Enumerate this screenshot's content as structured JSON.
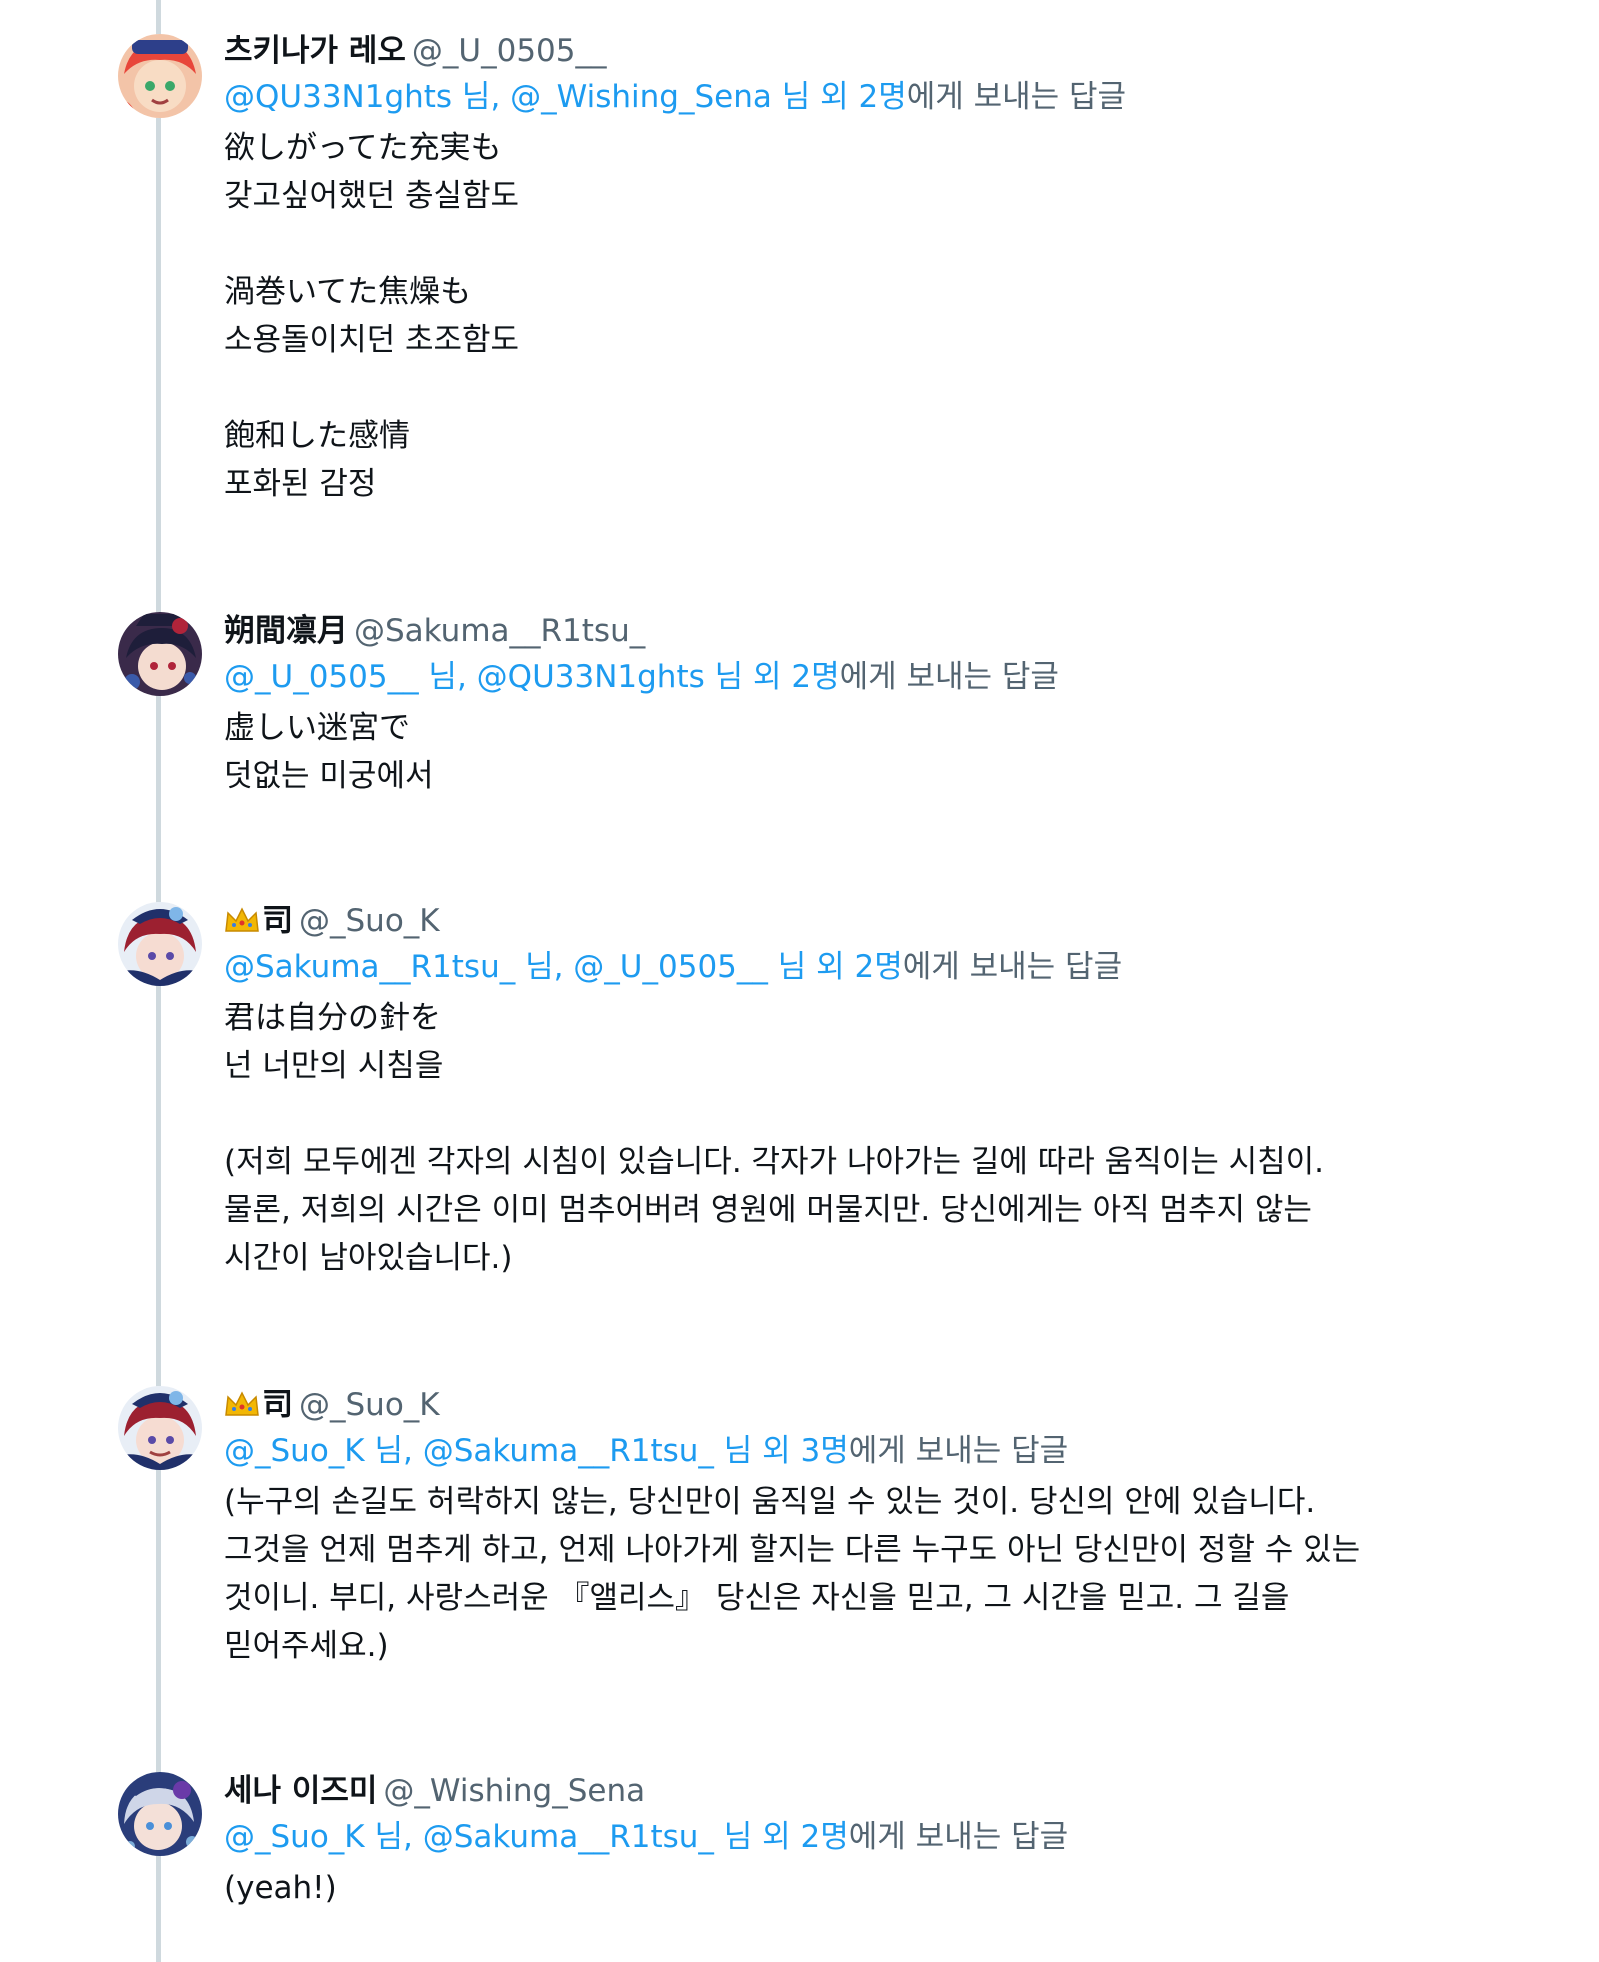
{
  "tweets": [
    {
      "display_name": "츠키나가 레오",
      "handle": "@_U_0505__",
      "reply_to": "@QU33N1ghts 님, @_Wishing_Sena 님 외 2명",
      "reply_suffix": "에게 보내는 답글",
      "text": "欲しがってた充実も\n갖고싶어했던 충실함도\n\n渦巻いてた焦燥も\n소용돌이치던 초조함도\n\n飽和した感情\n포화된 감정",
      "avatar_colors": [
        "#e8463a",
        "#2d3f8a",
        "#f5d08a"
      ]
    },
    {
      "display_name": "朔間凛月",
      "handle": "@Sakuma__R1tsu_",
      "reply_to": "@_U_0505__ 님, @QU33N1ghts 님 외 2명",
      "reply_suffix": "에게 보내는 답글",
      "text": "虚しい迷宮で\n덧없는 미궁에서",
      "avatar_colors": [
        "#1e1e3a",
        "#b0243a",
        "#3a6fd1"
      ]
    },
    {
      "crown_icon": "crown-emoji",
      "display_name": "司",
      "handle": "@_Suo_K",
      "reply_to": "@Sakuma__R1tsu_ 님, @_U_0505__ 님 외 2명",
      "reply_suffix": "에게 보내는 답글",
      "text": "君は自分の針を\n넌 너만의 시침을\n\n(저희 모두에겐 각자의 시침이 있습니다. 각자가 나아가는 길에 따라 움직이는 시침이.\n물론, 저희의 시간은 이미 멈추어버려 영원에 머물지만. 당신에게는 아직 멈추지 않는\n시간이 남아있습니다.)",
      "avatar_colors": [
        "#9c2030",
        "#20306a",
        "#7fb6e8"
      ]
    },
    {
      "crown_icon": "crown-emoji",
      "display_name": "司",
      "handle": "@_Suo_K",
      "reply_to": "@_Suo_K 님, @Sakuma__R1tsu_ 님 외 3명",
      "reply_suffix": "에게 보내는 답글",
      "text": "(누구의 손길도 허락하지 않는, 당신만이 움직일 수 있는 것이. 당신의 안에 있습니다.\n그것을 언제 멈추게 하고, 언제 나아가게 할지는 다른 누구도 아닌 당신만이 정할 수 있는\n것이니. 부디, 사랑스러운 『앨리스』 당신은 자신을 믿고, 그 시간을 믿고. 그 길을\n믿어주세요.)",
      "avatar_colors": [
        "#9c2030",
        "#20306a",
        "#7fb6e8"
      ]
    },
    {
      "display_name": "세나 이즈미",
      "handle": "@_Wishing_Sena",
      "reply_to": "@_Suo_K 님, @Sakuma__R1tsu_ 님 외 2명",
      "reply_suffix": "에게 보내는 답글",
      "text": "(yeah!)",
      "avatar_colors": [
        "#2a3d7a",
        "#8fc8f0",
        "#6a3aa8"
      ]
    }
  ]
}
